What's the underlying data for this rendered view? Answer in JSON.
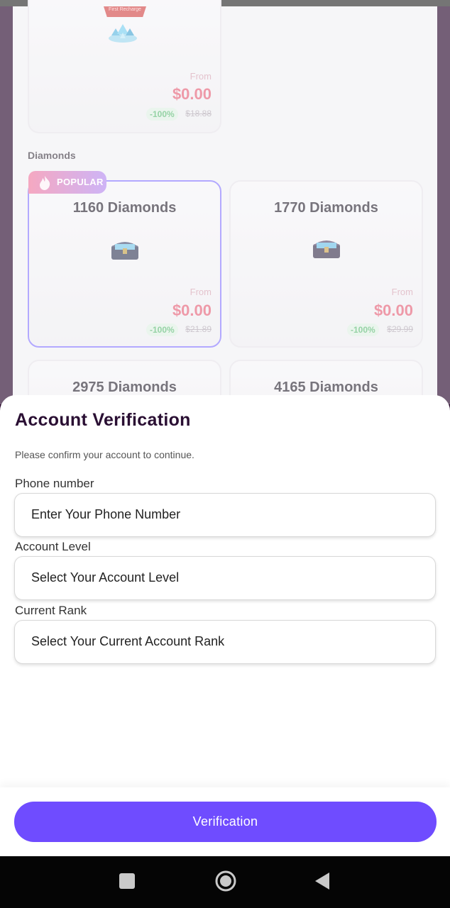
{
  "top_card": {
    "badge": "First Recharge",
    "from_label": "From",
    "price": "$0.00",
    "discount": "-100%",
    "old_price": "$18.88"
  },
  "section_title": "Diamonds",
  "popular_badge": "POPULAR",
  "cards": [
    {
      "title": "1160 Diamonds",
      "from_label": "From",
      "price": "$0.00",
      "discount": "-100%",
      "old_price": "$21.89"
    },
    {
      "title": "1770 Diamonds",
      "from_label": "From",
      "price": "$0.00",
      "discount": "-100%",
      "old_price": "$29.99"
    },
    {
      "title": "2975 Diamonds"
    },
    {
      "title": "4165 Diamonds"
    }
  ],
  "sheet": {
    "title": "Account Verification",
    "subtitle": "Please confirm your account to continue.",
    "phone_label": "Phone number",
    "phone_placeholder": "Enter Your Phone Number",
    "level_label": "Account Level",
    "level_placeholder": "Select Your Account Level",
    "rank_label": "Current Rank",
    "rank_placeholder": "Select Your Current Account Rank",
    "button": "Verification"
  },
  "colors": {
    "accent": "#6f4cff",
    "price": "#e5637a",
    "discount": "#5dbb75"
  },
  "nav_icons": [
    "recent-apps-icon",
    "home-icon",
    "back-icon"
  ]
}
